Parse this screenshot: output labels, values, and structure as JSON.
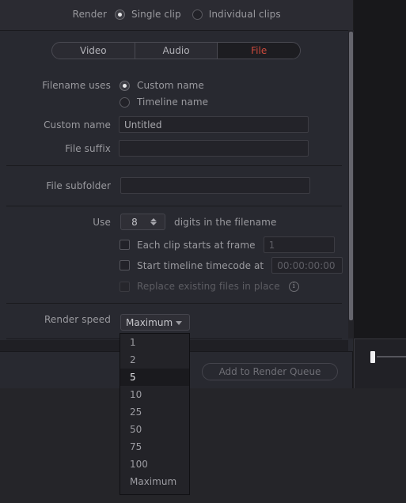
{
  "render_mode": {
    "label": "Render",
    "options": [
      {
        "label": "Single clip",
        "selected": true
      },
      {
        "label": "Individual clips",
        "selected": false
      }
    ]
  },
  "tabs": [
    {
      "label": "Video",
      "active": false
    },
    {
      "label": "Audio",
      "active": false
    },
    {
      "label": "File",
      "active": true
    }
  ],
  "filename_uses": {
    "label": "Filename uses",
    "options": [
      {
        "label": "Custom name",
        "selected": true
      },
      {
        "label": "Timeline name",
        "selected": false
      }
    ]
  },
  "custom_name": {
    "label": "Custom name",
    "value": "Untitled",
    "placeholder": ""
  },
  "file_suffix": {
    "label": "File suffix",
    "value": "",
    "placeholder": ""
  },
  "file_subfolder": {
    "label": "File subfolder",
    "value": "",
    "placeholder": ""
  },
  "digits": {
    "prefix_label": "Use",
    "value": "8",
    "suffix_label": "digits in the filename"
  },
  "each_clip_starts": {
    "label": "Each clip starts at frame",
    "checked": false,
    "value": "",
    "placeholder": "1"
  },
  "start_timecode": {
    "label": "Start timeline timecode at",
    "checked": false,
    "value": "",
    "placeholder": "00:00:00:00"
  },
  "replace_existing": {
    "label": "Replace existing files in place",
    "checked": false,
    "disabled": true,
    "info_glyph": "i"
  },
  "render_speed": {
    "label": "Render speed",
    "selected": "Maximum",
    "hovered": "5",
    "options": [
      "1",
      "2",
      "5",
      "10",
      "25",
      "50",
      "75",
      "100",
      "Maximum"
    ]
  },
  "add_to_render_queue": {
    "label": "Add to Render Queue"
  },
  "colors": {
    "accent_red": "#cc4a3c",
    "panel_bg": "#282930",
    "menu_bg": "#232328",
    "menu_sel_bg": "#1a1a1e",
    "text": "#9a9a9f",
    "text_dim": "#5d5d63",
    "scrollbar": "#65656d",
    "slider_thumb": "#f0f0f2"
  }
}
